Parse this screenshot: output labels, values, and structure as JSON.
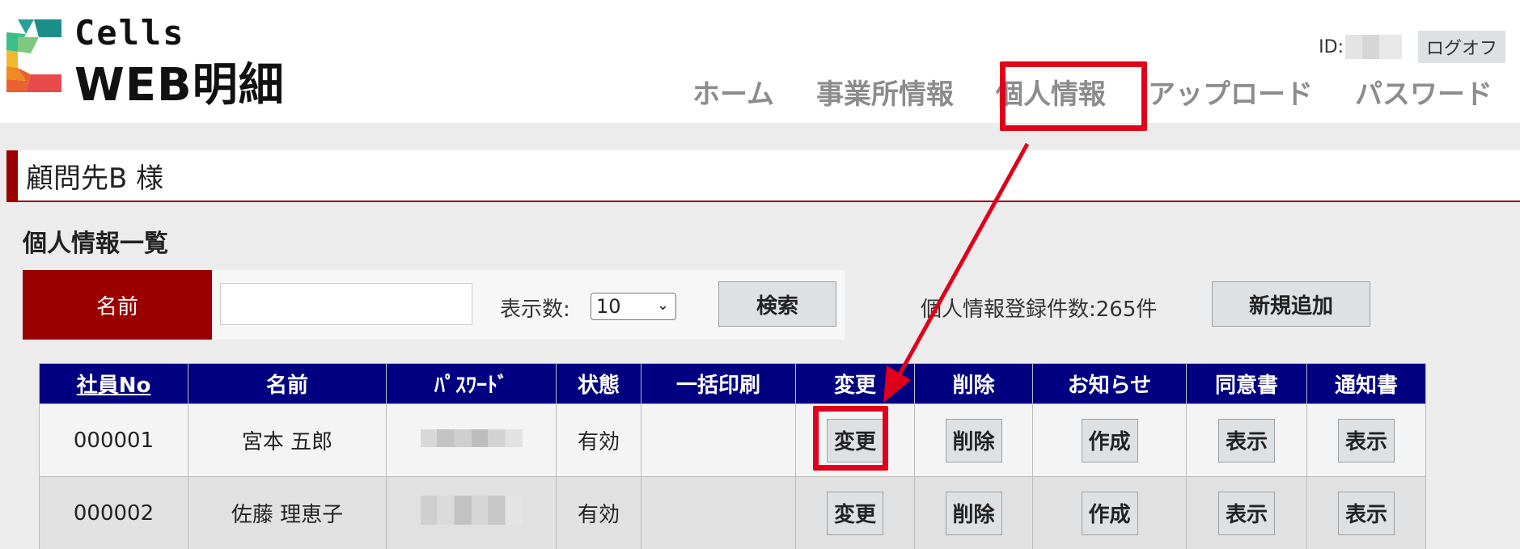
{
  "header": {
    "logo_top": "Cells",
    "logo_bottom": "WEB明細",
    "user_id_label": "ID:",
    "logoff_label": "ログオフ",
    "nav": [
      {
        "label": "ホーム",
        "name": "nav-home"
      },
      {
        "label": "事業所情報",
        "name": "nav-office-info"
      },
      {
        "label": "個人情報",
        "name": "nav-personal-info"
      },
      {
        "label": "アップロード",
        "name": "nav-upload"
      },
      {
        "label": "パスワード",
        "name": "nav-password"
      }
    ]
  },
  "client": {
    "name": "顧問先B 様"
  },
  "section_title": "個人情報一覧",
  "search": {
    "name_label": "名前",
    "name_value": "",
    "count_label": "表示数:",
    "count_value": "10",
    "search_button": "検索"
  },
  "registered_count": "個人情報登録件数:265件",
  "add_button": "新規追加",
  "table": {
    "headers": [
      "社員No",
      "名前",
      "ﾊﾟｽﾜｰﾄﾞ",
      "状態",
      "一括印刷",
      "変更",
      "削除",
      "お知らせ",
      "同意書",
      "通知書"
    ],
    "rows": [
      {
        "no": "000001",
        "name": "宮本 五郎",
        "status": "有効",
        "bulk_print": "",
        "edit": "変更",
        "delete": "削除",
        "notice": "作成",
        "consent": "表示",
        "notification": "表示"
      },
      {
        "no": "000002",
        "name": "佐藤 理恵子",
        "status": "有効",
        "bulk_print": "",
        "edit": "変更",
        "delete": "削除",
        "notice": "作成",
        "consent": "表示",
        "notification": "表示"
      }
    ]
  },
  "colors": {
    "accent_red": "#9b0000",
    "table_header": "#000080",
    "annotation_red": "#e0001b"
  }
}
